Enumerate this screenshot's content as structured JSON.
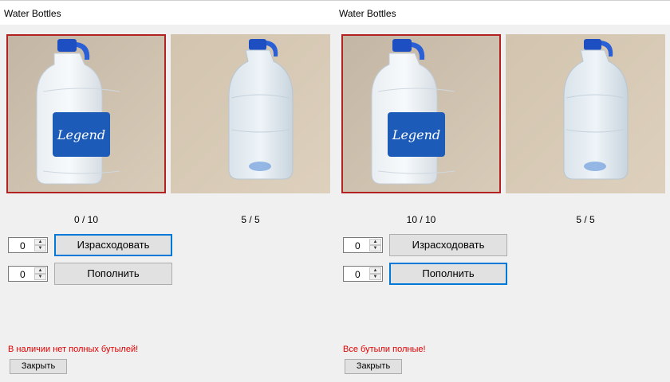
{
  "windows": [
    {
      "title": "Water Bottles",
      "full_count": "0 / 10",
      "empty_count": "5 / 5",
      "spend_qty": "0",
      "refill_qty": "0",
      "spend_label": "Израсходовать",
      "refill_label": "Пополнить",
      "message": "В наличии нет полных бутылей!",
      "close_label": "Закрыть",
      "focused_button": "spend"
    },
    {
      "title": "Water Bottles",
      "full_count": "10 / 10",
      "empty_count": "5 / 5",
      "spend_qty": "0",
      "refill_qty": "0",
      "spend_label": "Израсходовать",
      "refill_label": "Пополнить",
      "message": "Все бутыли полные!",
      "close_label": "Закрыть",
      "focused_button": "refill"
    }
  ],
  "images": {
    "full_bottle": {
      "label_text": "Legend",
      "icon": "water-bottle-full-photo"
    },
    "empty_bottle": {
      "icon": "water-bottle-empty-photo"
    }
  },
  "colors": {
    "message": "#e00000",
    "focus_border": "#0078d7",
    "selected_image_border": "#b22222"
  }
}
